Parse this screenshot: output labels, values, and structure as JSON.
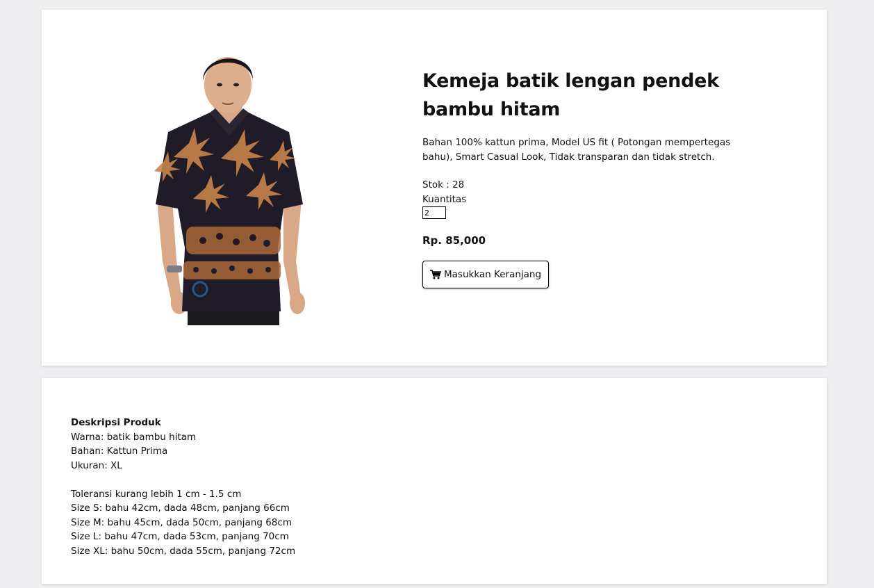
{
  "product": {
    "title": "Kemeja batik lengan pendek bambu hitam",
    "short_description": "Bahan 100% kattun prima, Model US fit ( Potongan mempertegas bahu), Smart Casual Look, Tidak transparan dan tidak stretch.",
    "stock_text": "Stok : 28",
    "quantity_label": "Kuantitas",
    "quantity_value": "2",
    "price": "Rp. 85,000",
    "add_to_cart_label": "Masukkan Keranjang",
    "cart_icon": "cart-icon"
  },
  "description": {
    "heading": "Deskripsi Produk",
    "lines": [
      "Warna: batik bambu hitam",
      "Bahan: Kattun Prima",
      "Ukuran: XL"
    ],
    "size_lines": [
      "Toleransi kurang lebih 1 cm - 1.5 cm",
      "Size S: bahu 42cm, dada 48cm, panjang 66cm",
      "Size M: bahu 45cm, dada 50cm, panjang 68cm",
      "Size L: bahu 47cm, dada 53cm, panjang 70cm",
      "Size XL: bahu 50cm, dada 55cm, panjang 72cm"
    ]
  },
  "colors": {
    "page_background": "#efeff1",
    "card_background": "#ffffff",
    "shirt_dark": "#201c27",
    "batik_accent": "#c8844a"
  }
}
